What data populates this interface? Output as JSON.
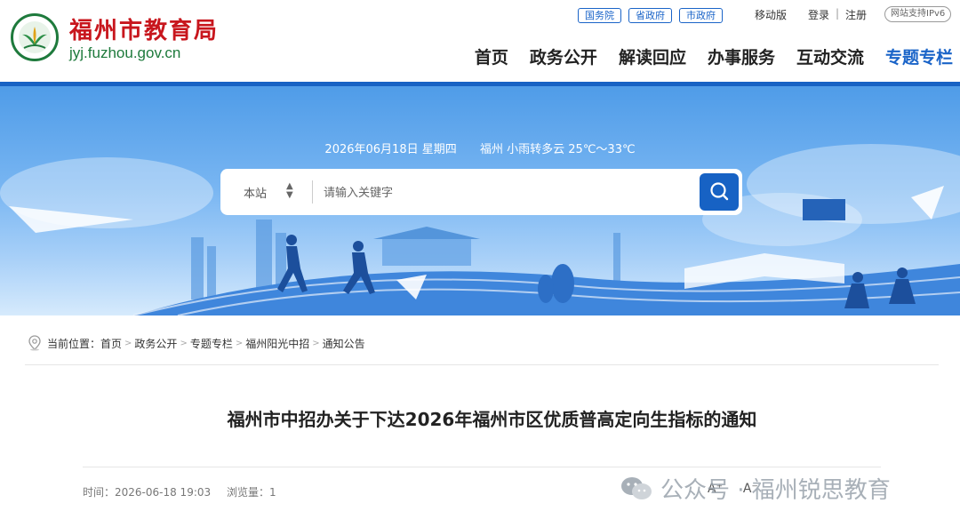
{
  "header": {
    "site_title": "福州市教育局",
    "domain": "jyj.fuzhou.gov.cn",
    "top_links": [
      "国务院",
      "省政府",
      "市政府"
    ],
    "mobile": "移动版",
    "login": "登录",
    "divider": "|",
    "register": "注册",
    "ipv6": "网站支持IPv6",
    "nav": [
      "首页",
      "政务公开",
      "解读回应",
      "办事服务",
      "互动交流",
      "专题专栏"
    ]
  },
  "banner": {
    "date": "2026年06月18日 星期四",
    "weather": "福州 小雨转多云 25℃～33℃",
    "search_scope": "本站",
    "search_placeholder": "请输入关键字"
  },
  "breadcrumb": {
    "label": "当前位置：",
    "items": [
      "首页",
      "政务公开",
      "专题专栏",
      "福州阳光中招",
      "通知公告"
    ]
  },
  "article": {
    "title": "福州市中招办关于下达2026年福州市区优质普高定向生指标的通知",
    "time": "时间：2026-06-18 19:03",
    "views": "浏览量：1",
    "font_large": "A⁺",
    "font_small": "A⁻"
  },
  "watermark": "公众号 · 福州锐思教育",
  "colors": {
    "brand_blue": "#1762c4",
    "title_red": "#c8161d",
    "logo_green": "#1e7a3c"
  }
}
